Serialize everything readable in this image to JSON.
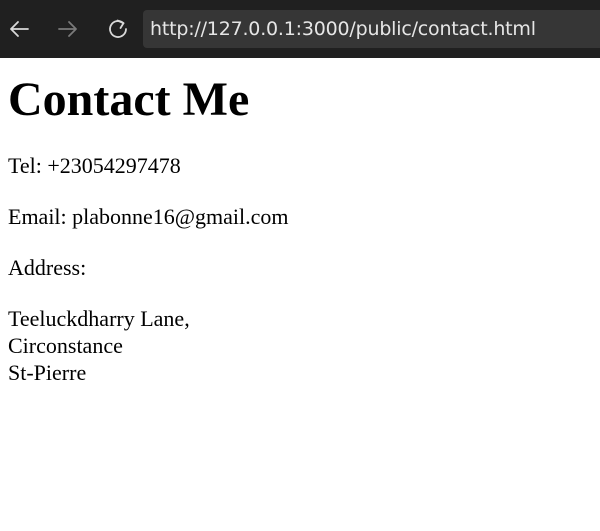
{
  "browser": {
    "url": "http://127.0.0.1:3000/public/contact.html",
    "icons": {
      "back": "arrow-left-icon",
      "forward": "arrow-right-icon",
      "reload": "reload-icon"
    }
  },
  "page": {
    "title": "Contact Me",
    "tel": "Tel: +23054297478",
    "email": "Email: plabonne16@gmail.com",
    "address_label": "Address:",
    "address_lines": [
      "Teeluckdharry Lane,",
      "Circonstance",
      "St-Pierre"
    ]
  }
}
